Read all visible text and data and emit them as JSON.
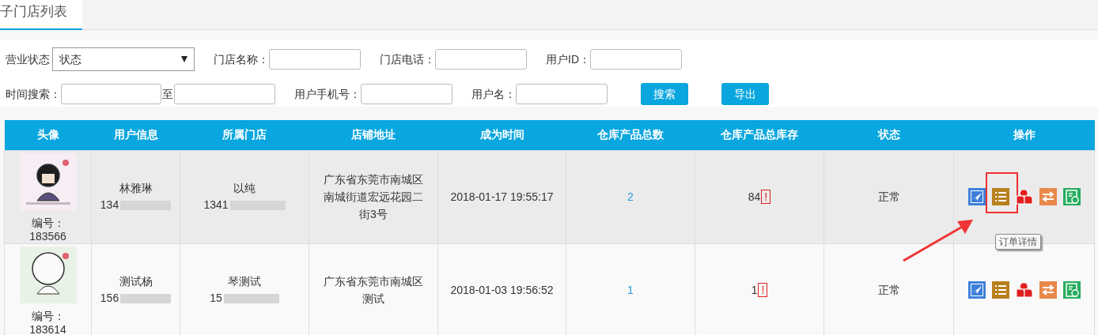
{
  "tabs": [
    {
      "label": "子门店列表",
      "selected": true
    }
  ],
  "filters": [
    [
      {
        "kind": "select",
        "label": "营业状态",
        "value": "状态"
      },
      {
        "kind": "input",
        "label": "门店名称："
      },
      {
        "kind": "input",
        "label": "门店电话："
      },
      {
        "kind": "input",
        "label": "用户ID："
      }
    ],
    [
      {
        "kind": "range",
        "label": "时间搜索：",
        "separator": "至"
      },
      {
        "kind": "input",
        "label": "用户手机号："
      },
      {
        "kind": "input",
        "label": "用户名："
      },
      {
        "kind": "button",
        "label": "搜索"
      },
      {
        "kind": "button",
        "label": "导出"
      }
    ]
  ],
  "table": {
    "columns": [
      "头像",
      "用户信息",
      "所属门店",
      "店铺地址",
      "成为时间",
      "仓库产品总数",
      "仓库产品总库存",
      "状态",
      "操作"
    ],
    "rows": [
      {
        "id_label": "编号：",
        "id": "183566",
        "user_name": "林雅琳",
        "user_phone": "134",
        "store_name": "以纯",
        "store_phone": "1341",
        "address": "广东省东莞市南城区南城街道宏远花园二街3号",
        "joined": "2018-01-17 19:55:17",
        "product_count": "2",
        "stock": "84",
        "stock_alert": "!",
        "status": "正常",
        "actions": [
          {
            "kind": "send",
            "highlighted": false
          },
          {
            "kind": "list",
            "highlighted": true,
            "tooltip": "订单详情"
          },
          {
            "kind": "boxes",
            "highlighted": false
          },
          {
            "kind": "swap",
            "highlighted": false
          },
          {
            "kind": "ledger",
            "highlighted": false
          }
        ]
      },
      {
        "id_label": "编号：",
        "id": "183614",
        "user_name": "测试杨",
        "user_phone": "156",
        "store_name": "琴测试",
        "store_phone": "15",
        "address": "广东省东莞市南城区测试",
        "joined": "2018-01-03 19:56:52",
        "product_count": "1",
        "stock": "1",
        "stock_alert": "!",
        "status": "正常",
        "actions": [
          {
            "kind": "send",
            "highlighted": false
          },
          {
            "kind": "list",
            "highlighted": false
          },
          {
            "kind": "boxes",
            "highlighted": false
          },
          {
            "kind": "swap",
            "highlighted": false
          },
          {
            "kind": "ledger",
            "highlighted": false
          }
        ]
      }
    ]
  }
}
